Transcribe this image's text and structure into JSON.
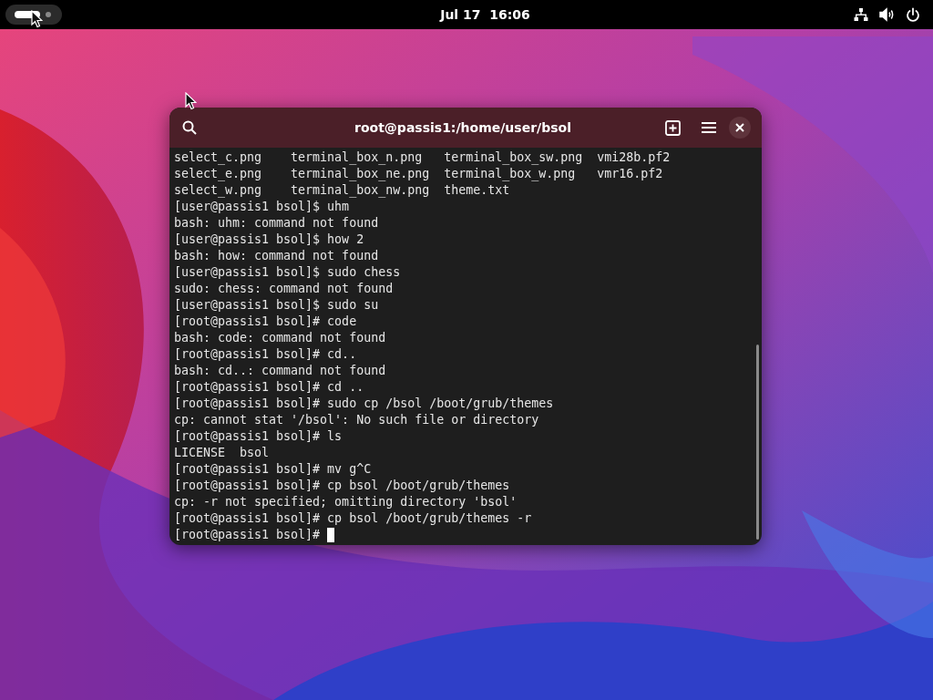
{
  "top_bar": {
    "clock": "Jul 17  16:06"
  },
  "terminal": {
    "title": "root@passis1:/home/user/bsol",
    "lines": [
      {
        "text": "select_c.png    terminal_box_n.png   terminal_box_sw.png  vmi28b.pf2",
        "cursor": false
      },
      {
        "text": "select_e.png    terminal_box_ne.png  terminal_box_w.png   vmr16.pf2",
        "cursor": false
      },
      {
        "text": "select_w.png    terminal_box_nw.png  theme.txt",
        "cursor": false
      },
      {
        "text": "[user@passis1 bsol]$ uhm",
        "cursor": false
      },
      {
        "text": "bash: uhm: command not found",
        "cursor": false
      },
      {
        "text": "[user@passis1 bsol]$ how 2",
        "cursor": false
      },
      {
        "text": "bash: how: command not found",
        "cursor": false
      },
      {
        "text": "[user@passis1 bsol]$ sudo chess",
        "cursor": false
      },
      {
        "text": "sudo: chess: command not found",
        "cursor": false
      },
      {
        "text": "[user@passis1 bsol]$ sudo su",
        "cursor": false
      },
      {
        "text": "[root@passis1 bsol]# code",
        "cursor": false
      },
      {
        "text": "bash: code: command not found",
        "cursor": false
      },
      {
        "text": "[root@passis1 bsol]# cd..",
        "cursor": false
      },
      {
        "text": "bash: cd..: command not found",
        "cursor": false
      },
      {
        "text": "[root@passis1 bsol]# cd ..",
        "cursor": false
      },
      {
        "text": "[root@passis1 bsol]# sudo cp /bsol /boot/grub/themes",
        "cursor": false
      },
      {
        "text": "cp: cannot stat '/bsol': No such file or directory",
        "cursor": false
      },
      {
        "text": "[root@passis1 bsol]# ls",
        "cursor": false
      },
      {
        "text": "LICENSE  bsol",
        "cursor": false
      },
      {
        "text": "[root@passis1 bsol]# mv g^C",
        "cursor": false
      },
      {
        "text": "[root@passis1 bsol]# cp bsol /boot/grub/themes",
        "cursor": false
      },
      {
        "text": "cp: -r not specified; omitting directory 'bsol'",
        "cursor": false
      },
      {
        "text": "[root@passis1 bsol]# cp bsol /boot/grub/themes -r",
        "cursor": false
      },
      {
        "text": "[root@passis1 bsol]# ",
        "cursor": true
      }
    ]
  }
}
